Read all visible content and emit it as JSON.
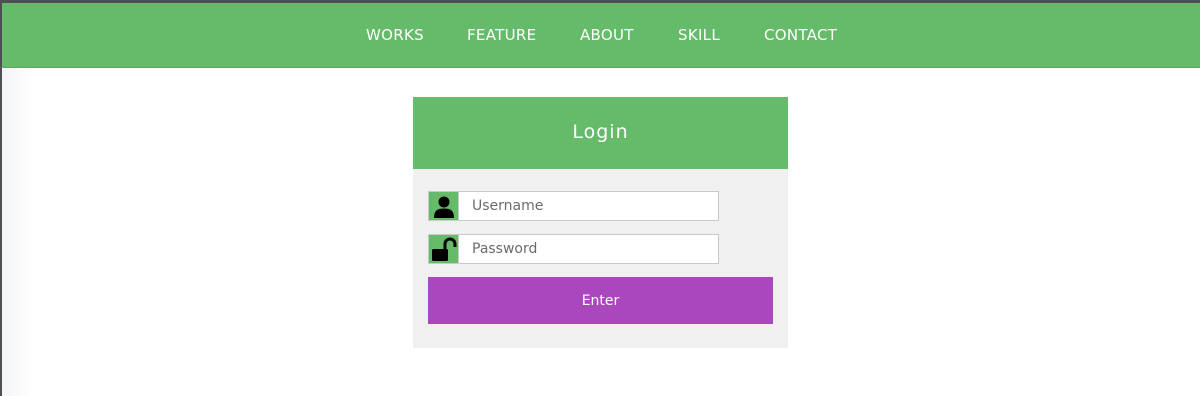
{
  "nav": {
    "items": [
      {
        "label": "WORKS"
      },
      {
        "label": "FEATURE"
      },
      {
        "label": "ABOUT"
      },
      {
        "label": "SKILL"
      },
      {
        "label": "CONTACT"
      }
    ]
  },
  "login": {
    "title": "Login",
    "username": {
      "placeholder": "Username",
      "value": "",
      "icon": "user-icon"
    },
    "password": {
      "placeholder": "Password",
      "value": "",
      "icon": "unlocked-padlock-icon"
    },
    "enter_label": "Enter"
  },
  "colors": {
    "brand_green": "#66bb6a",
    "button_purple": "#ab47bc",
    "card_background": "#f0f0f0"
  }
}
